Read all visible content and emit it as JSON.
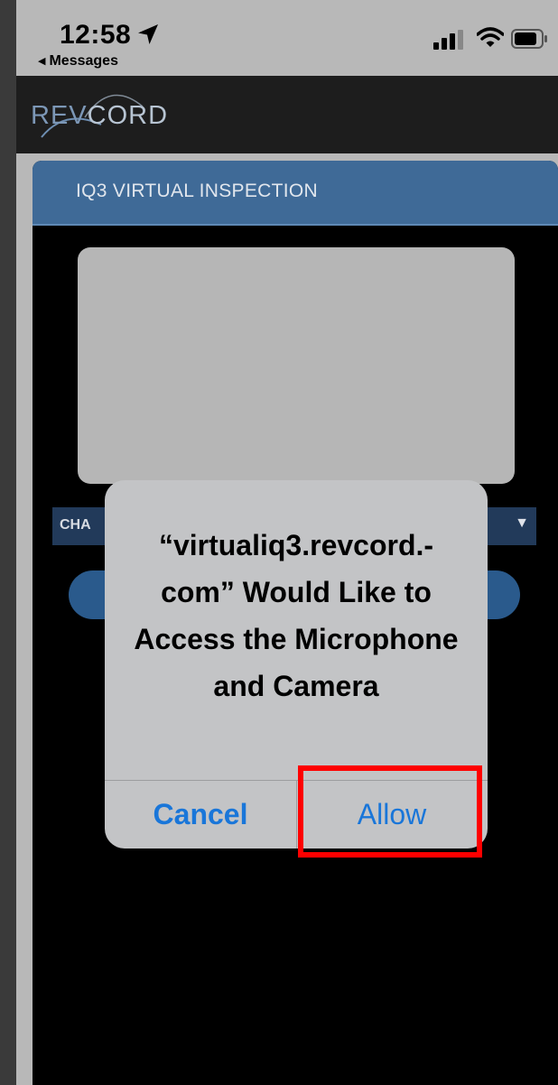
{
  "status_bar": {
    "time": "12:58",
    "back_label": "Messages",
    "location_icon": "location-arrow-icon",
    "signal_icon": "cellular-signal-icon",
    "wifi_icon": "wifi-icon",
    "battery_icon": "battery-icon"
  },
  "app_header": {
    "logo_part1": "REV",
    "logo_part2": "CORD"
  },
  "panel": {
    "title": "IQ3 VIRTUAL INSPECTION",
    "channel_label": "CHA",
    "caret": "▼"
  },
  "alert": {
    "title": "“virtualiq3.revcord.-com” Would Like to Access the Microphone and Camera",
    "cancel_label": "Cancel",
    "allow_label": "Allow"
  },
  "colors": {
    "highlight": "#ff0000",
    "link_blue": "#1976d9",
    "panel_header": "#3f6a97"
  }
}
